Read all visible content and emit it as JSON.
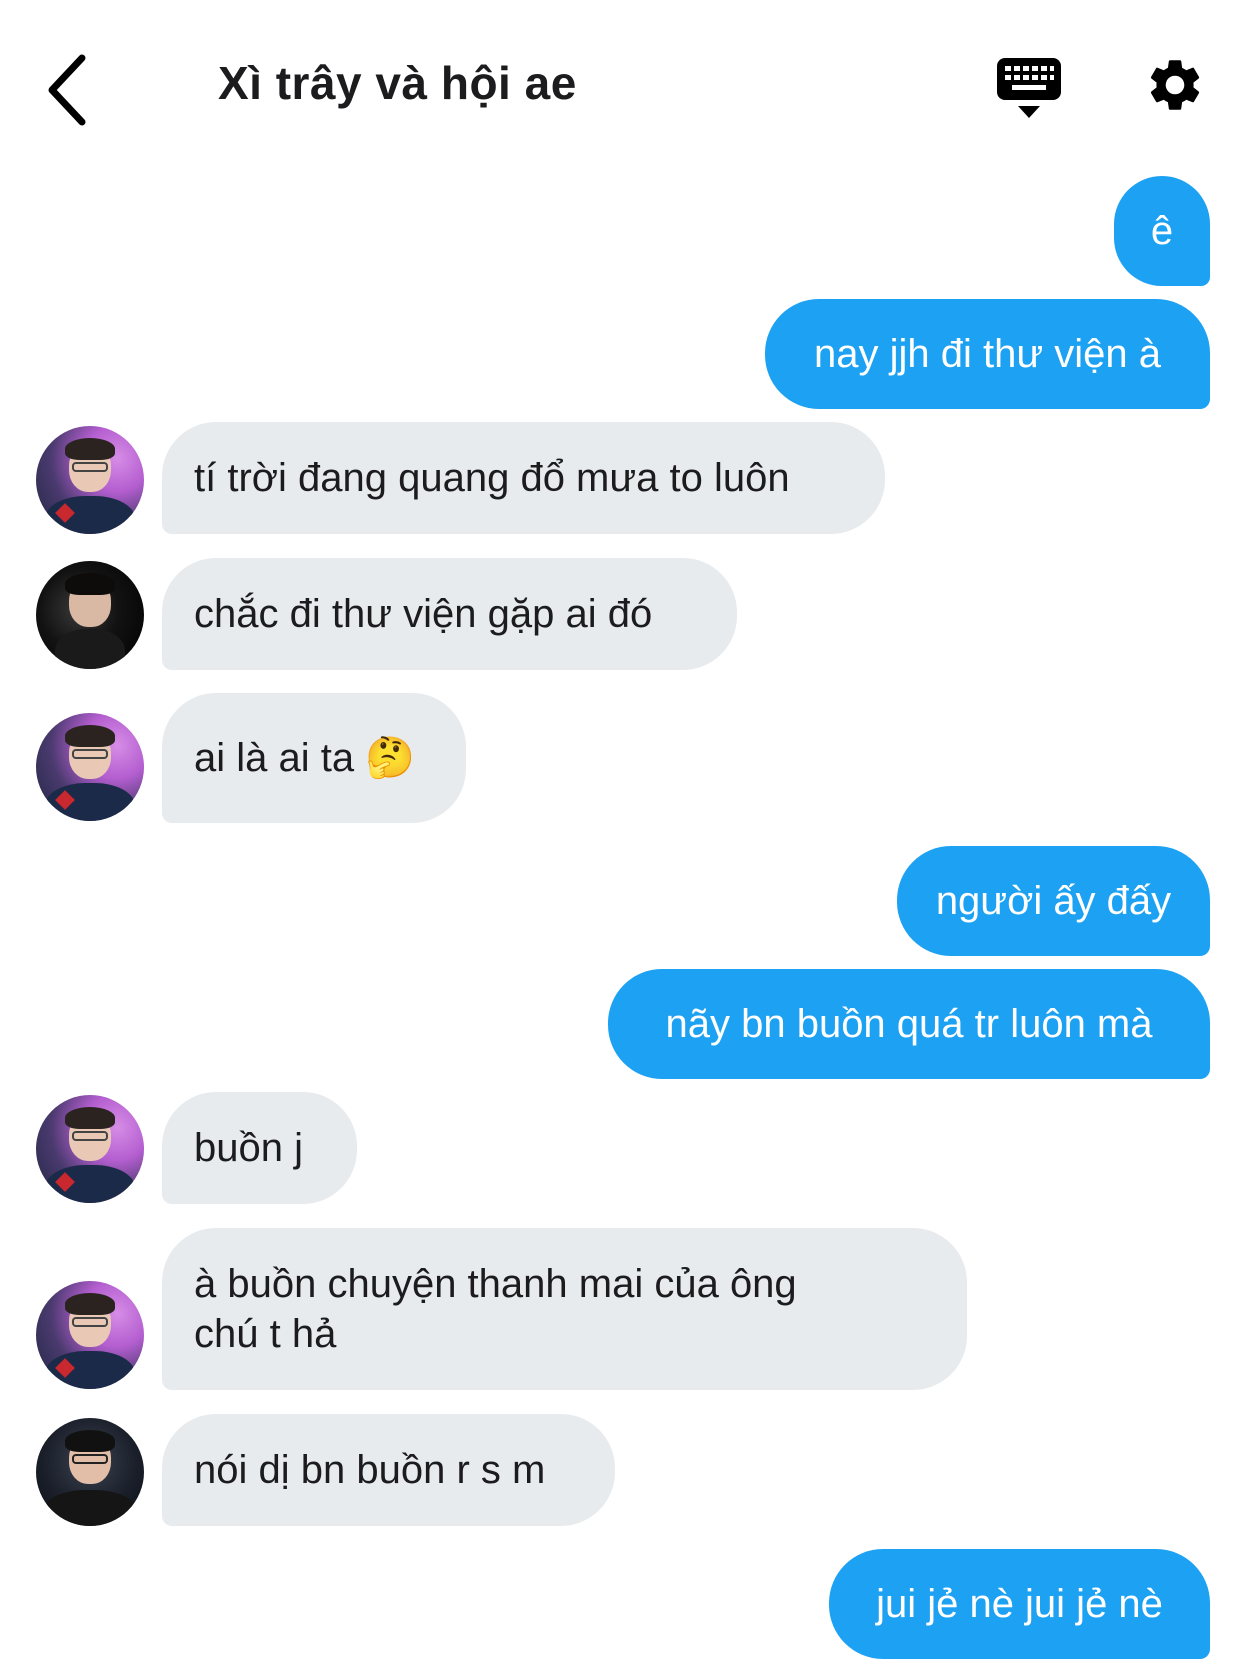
{
  "header": {
    "title": "Xì trây và hội ae"
  },
  "messages": [
    {
      "from": "me",
      "text": "ê"
    },
    {
      "from": "me",
      "text": "nay jjh đi thư viện à"
    },
    {
      "from": "member-1",
      "text": "tí trời đang quang đổ mưa to luôn"
    },
    {
      "from": "member-2",
      "text": "chắc đi thư viện gặp ai đó"
    },
    {
      "from": "member-1",
      "text": "ai là ai ta 🤔"
    },
    {
      "from": "me",
      "text": "người ấy đấy"
    },
    {
      "from": "me",
      "text": "nãy bn buồn quá tr luôn mà"
    },
    {
      "from": "member-1",
      "text": "buồn j"
    },
    {
      "from": "member-1",
      "line1": "à buồn chuyện thanh mai của ông",
      "line2": "chú t hả"
    },
    {
      "from": "member-3",
      "text": "nói dị bn buồn r s m"
    },
    {
      "from": "me",
      "text": "jui jẻ nè jui jẻ nè"
    }
  ],
  "colors": {
    "outgoing_bubble": "#1da1f2",
    "incoming_bubble": "#e8ebee",
    "background": "#ffffff"
  },
  "icons": [
    "back-chevron-icon",
    "keyboard-icon",
    "settings-gear-icon"
  ]
}
